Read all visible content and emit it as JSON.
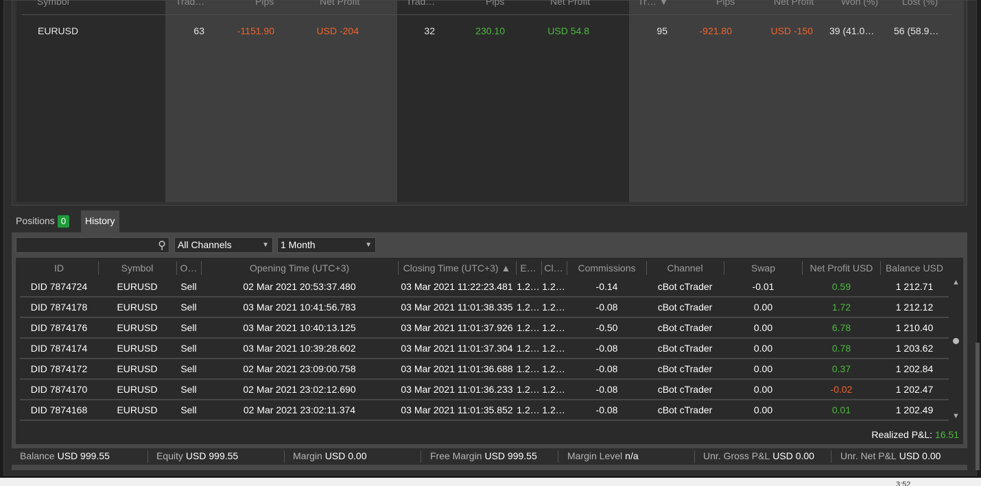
{
  "stats": {
    "headers": {
      "symbol": "Symbol",
      "g1_trades": "Trad…",
      "g1_pips": "Pips",
      "g1_net": "Net Profit",
      "g2_trades": "Trad…",
      "g2_pips": "Pips",
      "g2_net": "Net Profit",
      "g3_trades": "Tr… ▼",
      "g3_pips": "Pips",
      "g3_net": "Net Profit",
      "won": "Won (%)",
      "lost": "Lost (%)"
    },
    "row": {
      "symbol": "EURUSD",
      "g1_trades": "63",
      "g1_pips": "-1151.90",
      "g1_net": "USD -204",
      "g2_trades": "32",
      "g2_pips": "230.10",
      "g2_net": "USD 54.8",
      "g3_trades": "95",
      "g3_pips": "-921.80",
      "g3_net": "USD -150",
      "won": "39 (41.0…",
      "lost": "56 (58.9…"
    }
  },
  "tabs": {
    "positions": "Positions",
    "positions_count": "0",
    "history": "History"
  },
  "filters": {
    "channels": "All Channels",
    "period": "1 Month"
  },
  "grid": {
    "headers": {
      "id": "ID",
      "symbol": "Symbol",
      "order": "O…",
      "open_time": "Opening Time (UTC+3)",
      "close_time": "Closing Time (UTC+3) ▲",
      "entry": "E…",
      "close": "Cl…",
      "commissions": "Commissions",
      "channel": "Channel",
      "swap": "Swap",
      "net_profit": "Net Profit USD",
      "balance": "Balance USD"
    },
    "rows": [
      {
        "id": "DID 7874724",
        "symbol": "EURUSD",
        "side": "Sell",
        "open": "02 Mar 2021 20:53:37.480",
        "close": "03 Mar 2021 11:22:23.481",
        "entry": "1.2…",
        "closep": "1.2…",
        "comm": "-0.14",
        "channel": "cBot cTrader",
        "swap": "-0.01",
        "net": "0.59",
        "bal": "1 212.71"
      },
      {
        "id": "DID 7874178",
        "symbol": "EURUSD",
        "side": "Sell",
        "open": "03 Mar 2021 10:41:56.783",
        "close": "03 Mar 2021 11:01:38.335",
        "entry": "1.2…",
        "closep": "1.2…",
        "comm": "-0.08",
        "channel": "cBot cTrader",
        "swap": "0.00",
        "net": "1.72",
        "bal": "1 212.12"
      },
      {
        "id": "DID 7874176",
        "symbol": "EURUSD",
        "side": "Sell",
        "open": "03 Mar 2021 10:40:13.125",
        "close": "03 Mar 2021 11:01:37.926",
        "entry": "1.2…",
        "closep": "1.2…",
        "comm": "-0.50",
        "channel": "cBot cTrader",
        "swap": "0.00",
        "net": "6.78",
        "bal": "1 210.40"
      },
      {
        "id": "DID 7874174",
        "symbol": "EURUSD",
        "side": "Sell",
        "open": "03 Mar 2021 10:39:28.602",
        "close": "03 Mar 2021 11:01:37.304",
        "entry": "1.2…",
        "closep": "1.2…",
        "comm": "-0.08",
        "channel": "cBot cTrader",
        "swap": "0.00",
        "net": "0.78",
        "bal": "1 203.62"
      },
      {
        "id": "DID 7874172",
        "symbol": "EURUSD",
        "side": "Sell",
        "open": "02 Mar 2021 23:09:00.758",
        "close": "03 Mar 2021 11:01:36.688",
        "entry": "1.2…",
        "closep": "1.2…",
        "comm": "-0.08",
        "channel": "cBot cTrader",
        "swap": "0.00",
        "net": "0.37",
        "bal": "1 202.84"
      },
      {
        "id": "DID 7874170",
        "symbol": "EURUSD",
        "side": "Sell",
        "open": "02 Mar 2021 23:02:12.690",
        "close": "03 Mar 2021 11:01:36.233",
        "entry": "1.2…",
        "closep": "1.2…",
        "comm": "-0.08",
        "channel": "cBot cTrader",
        "swap": "0.00",
        "net": "-0.02",
        "bal": "1 202.47"
      },
      {
        "id": "DID 7874168",
        "symbol": "EURUSD",
        "side": "Sell",
        "open": "02 Mar 2021 23:02:11.374",
        "close": "03 Mar 2021 11:01:35.852",
        "entry": "1.2…",
        "closep": "1.2…",
        "comm": "-0.08",
        "channel": "cBot cTrader",
        "swap": "0.00",
        "net": "0.01",
        "bal": "1 202.49"
      }
    ]
  },
  "realized": {
    "label": "Realized P&L:",
    "value": "16.51"
  },
  "statusbar": {
    "balance_label": "Balance",
    "balance": "USD 999.55",
    "equity_label": "Equity",
    "equity": "USD 999.55",
    "margin_label": "Margin",
    "margin": "USD 0.00",
    "free_label": "Free Margin",
    "free": "USD 999.55",
    "level_label": "Margin Level",
    "level": "n/a",
    "gross_label": "Unr. Gross P&L",
    "gross": "USD 0.00",
    "net_label": "Unr. Net P&L",
    "net": "USD 0.00"
  },
  "taskbar": {
    "clock": "3:52"
  },
  "colors": {
    "negative": "#f0642d",
    "positive": "#4dba3e",
    "badge": "#1f9a3a"
  }
}
